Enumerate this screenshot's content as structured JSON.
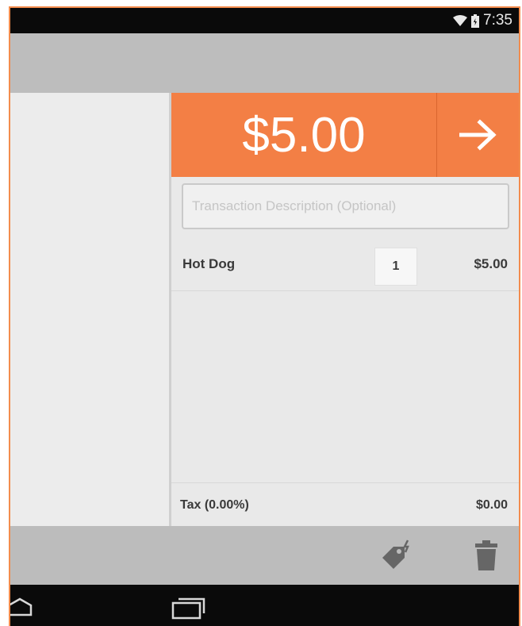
{
  "status_bar": {
    "time": "7:35",
    "icons": [
      "wifi-icon",
      "battery-icon"
    ]
  },
  "colors": {
    "accent": "#f37f45",
    "status_bar": "#0a0a0a",
    "action_bar": "#bdbdbd",
    "pane_background": "#e9e9e9"
  },
  "sale": {
    "total": "$5.00",
    "next_icon": "arrow-right-icon"
  },
  "description": {
    "value": "",
    "placeholder": "Transaction Description (Optional)"
  },
  "items": [
    {
      "name": "Hot Dog",
      "quantity": "1",
      "price": "$5.00"
    }
  ],
  "tax": {
    "label": "Tax (0.00%)",
    "value": "$0.00"
  },
  "bottom_actions": {
    "icons": [
      "discount-tag-icon",
      "trash-icon"
    ]
  },
  "nav_bar": {
    "icons": [
      "home-icon",
      "recents-icon"
    ]
  }
}
